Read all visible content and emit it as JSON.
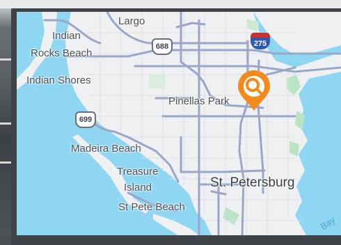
{
  "map": {
    "places": {
      "largo": "Largo",
      "indian_rocks_1": "Indian",
      "indian_rocks_2": "Rocks Beach",
      "indian_shores": "Indian Shores",
      "pinellas_park": "Pinellas Park",
      "madeira_beach": "Madeira Beach",
      "treasure_1": "Treasure",
      "treasure_2": "Island",
      "st_petersburg": "St. Petersburg",
      "st_pete_beach": "St Pete Beach",
      "bay_fragment": "Bay"
    },
    "shields": {
      "route_688": "688",
      "route_699": "699",
      "interstate_275": "275"
    },
    "marker_icon": "location-pin-magnifier-icon",
    "colors": {
      "water": "#8ed6f2",
      "land": "#eef0f2",
      "park": "#b9e5c4",
      "road": "#9aa6c8",
      "marker": "#f28a1c"
    }
  }
}
